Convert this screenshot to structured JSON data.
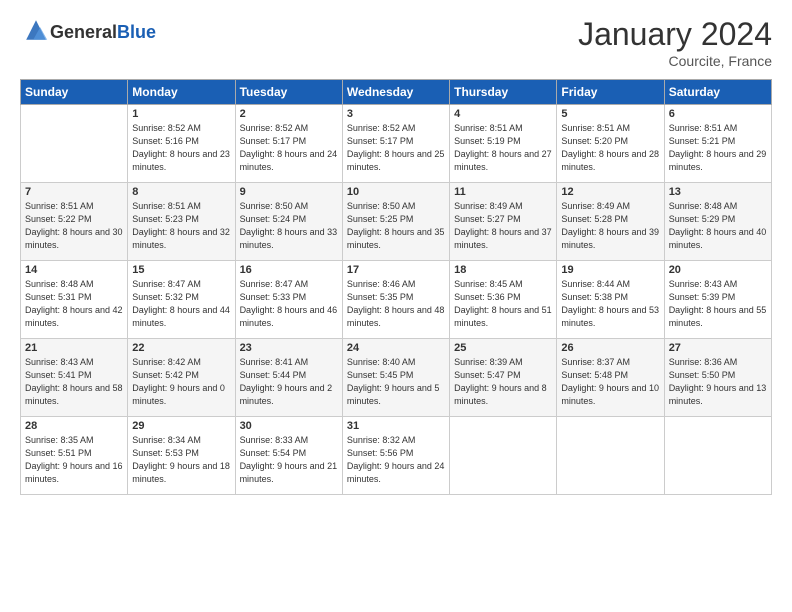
{
  "logo": {
    "general": "General",
    "blue": "Blue"
  },
  "title": "January 2024",
  "location": "Courcite, France",
  "days_header": [
    "Sunday",
    "Monday",
    "Tuesday",
    "Wednesday",
    "Thursday",
    "Friday",
    "Saturday"
  ],
  "weeks": [
    [
      {
        "num": "",
        "sunrise": "",
        "sunset": "",
        "daylight": ""
      },
      {
        "num": "1",
        "sunrise": "Sunrise: 8:52 AM",
        "sunset": "Sunset: 5:16 PM",
        "daylight": "Daylight: 8 hours and 23 minutes."
      },
      {
        "num": "2",
        "sunrise": "Sunrise: 8:52 AM",
        "sunset": "Sunset: 5:17 PM",
        "daylight": "Daylight: 8 hours and 24 minutes."
      },
      {
        "num": "3",
        "sunrise": "Sunrise: 8:52 AM",
        "sunset": "Sunset: 5:17 PM",
        "daylight": "Daylight: 8 hours and 25 minutes."
      },
      {
        "num": "4",
        "sunrise": "Sunrise: 8:51 AM",
        "sunset": "Sunset: 5:19 PM",
        "daylight": "Daylight: 8 hours and 27 minutes."
      },
      {
        "num": "5",
        "sunrise": "Sunrise: 8:51 AM",
        "sunset": "Sunset: 5:20 PM",
        "daylight": "Daylight: 8 hours and 28 minutes."
      },
      {
        "num": "6",
        "sunrise": "Sunrise: 8:51 AM",
        "sunset": "Sunset: 5:21 PM",
        "daylight": "Daylight: 8 hours and 29 minutes."
      }
    ],
    [
      {
        "num": "7",
        "sunrise": "Sunrise: 8:51 AM",
        "sunset": "Sunset: 5:22 PM",
        "daylight": "Daylight: 8 hours and 30 minutes."
      },
      {
        "num": "8",
        "sunrise": "Sunrise: 8:51 AM",
        "sunset": "Sunset: 5:23 PM",
        "daylight": "Daylight: 8 hours and 32 minutes."
      },
      {
        "num": "9",
        "sunrise": "Sunrise: 8:50 AM",
        "sunset": "Sunset: 5:24 PM",
        "daylight": "Daylight: 8 hours and 33 minutes."
      },
      {
        "num": "10",
        "sunrise": "Sunrise: 8:50 AM",
        "sunset": "Sunset: 5:25 PM",
        "daylight": "Daylight: 8 hours and 35 minutes."
      },
      {
        "num": "11",
        "sunrise": "Sunrise: 8:49 AM",
        "sunset": "Sunset: 5:27 PM",
        "daylight": "Daylight: 8 hours and 37 minutes."
      },
      {
        "num": "12",
        "sunrise": "Sunrise: 8:49 AM",
        "sunset": "Sunset: 5:28 PM",
        "daylight": "Daylight: 8 hours and 39 minutes."
      },
      {
        "num": "13",
        "sunrise": "Sunrise: 8:48 AM",
        "sunset": "Sunset: 5:29 PM",
        "daylight": "Daylight: 8 hours and 40 minutes."
      }
    ],
    [
      {
        "num": "14",
        "sunrise": "Sunrise: 8:48 AM",
        "sunset": "Sunset: 5:31 PM",
        "daylight": "Daylight: 8 hours and 42 minutes."
      },
      {
        "num": "15",
        "sunrise": "Sunrise: 8:47 AM",
        "sunset": "Sunset: 5:32 PM",
        "daylight": "Daylight: 8 hours and 44 minutes."
      },
      {
        "num": "16",
        "sunrise": "Sunrise: 8:47 AM",
        "sunset": "Sunset: 5:33 PM",
        "daylight": "Daylight: 8 hours and 46 minutes."
      },
      {
        "num": "17",
        "sunrise": "Sunrise: 8:46 AM",
        "sunset": "Sunset: 5:35 PM",
        "daylight": "Daylight: 8 hours and 48 minutes."
      },
      {
        "num": "18",
        "sunrise": "Sunrise: 8:45 AM",
        "sunset": "Sunset: 5:36 PM",
        "daylight": "Daylight: 8 hours and 51 minutes."
      },
      {
        "num": "19",
        "sunrise": "Sunrise: 8:44 AM",
        "sunset": "Sunset: 5:38 PM",
        "daylight": "Daylight: 8 hours and 53 minutes."
      },
      {
        "num": "20",
        "sunrise": "Sunrise: 8:43 AM",
        "sunset": "Sunset: 5:39 PM",
        "daylight": "Daylight: 8 hours and 55 minutes."
      }
    ],
    [
      {
        "num": "21",
        "sunrise": "Sunrise: 8:43 AM",
        "sunset": "Sunset: 5:41 PM",
        "daylight": "Daylight: 8 hours and 58 minutes."
      },
      {
        "num": "22",
        "sunrise": "Sunrise: 8:42 AM",
        "sunset": "Sunset: 5:42 PM",
        "daylight": "Daylight: 9 hours and 0 minutes."
      },
      {
        "num": "23",
        "sunrise": "Sunrise: 8:41 AM",
        "sunset": "Sunset: 5:44 PM",
        "daylight": "Daylight: 9 hours and 2 minutes."
      },
      {
        "num": "24",
        "sunrise": "Sunrise: 8:40 AM",
        "sunset": "Sunset: 5:45 PM",
        "daylight": "Daylight: 9 hours and 5 minutes."
      },
      {
        "num": "25",
        "sunrise": "Sunrise: 8:39 AM",
        "sunset": "Sunset: 5:47 PM",
        "daylight": "Daylight: 9 hours and 8 minutes."
      },
      {
        "num": "26",
        "sunrise": "Sunrise: 8:37 AM",
        "sunset": "Sunset: 5:48 PM",
        "daylight": "Daylight: 9 hours and 10 minutes."
      },
      {
        "num": "27",
        "sunrise": "Sunrise: 8:36 AM",
        "sunset": "Sunset: 5:50 PM",
        "daylight": "Daylight: 9 hours and 13 minutes."
      }
    ],
    [
      {
        "num": "28",
        "sunrise": "Sunrise: 8:35 AM",
        "sunset": "Sunset: 5:51 PM",
        "daylight": "Daylight: 9 hours and 16 minutes."
      },
      {
        "num": "29",
        "sunrise": "Sunrise: 8:34 AM",
        "sunset": "Sunset: 5:53 PM",
        "daylight": "Daylight: 9 hours and 18 minutes."
      },
      {
        "num": "30",
        "sunrise": "Sunrise: 8:33 AM",
        "sunset": "Sunset: 5:54 PM",
        "daylight": "Daylight: 9 hours and 21 minutes."
      },
      {
        "num": "31",
        "sunrise": "Sunrise: 8:32 AM",
        "sunset": "Sunset: 5:56 PM",
        "daylight": "Daylight: 9 hours and 24 minutes."
      },
      {
        "num": "",
        "sunrise": "",
        "sunset": "",
        "daylight": ""
      },
      {
        "num": "",
        "sunrise": "",
        "sunset": "",
        "daylight": ""
      },
      {
        "num": "",
        "sunrise": "",
        "sunset": "",
        "daylight": ""
      }
    ]
  ]
}
